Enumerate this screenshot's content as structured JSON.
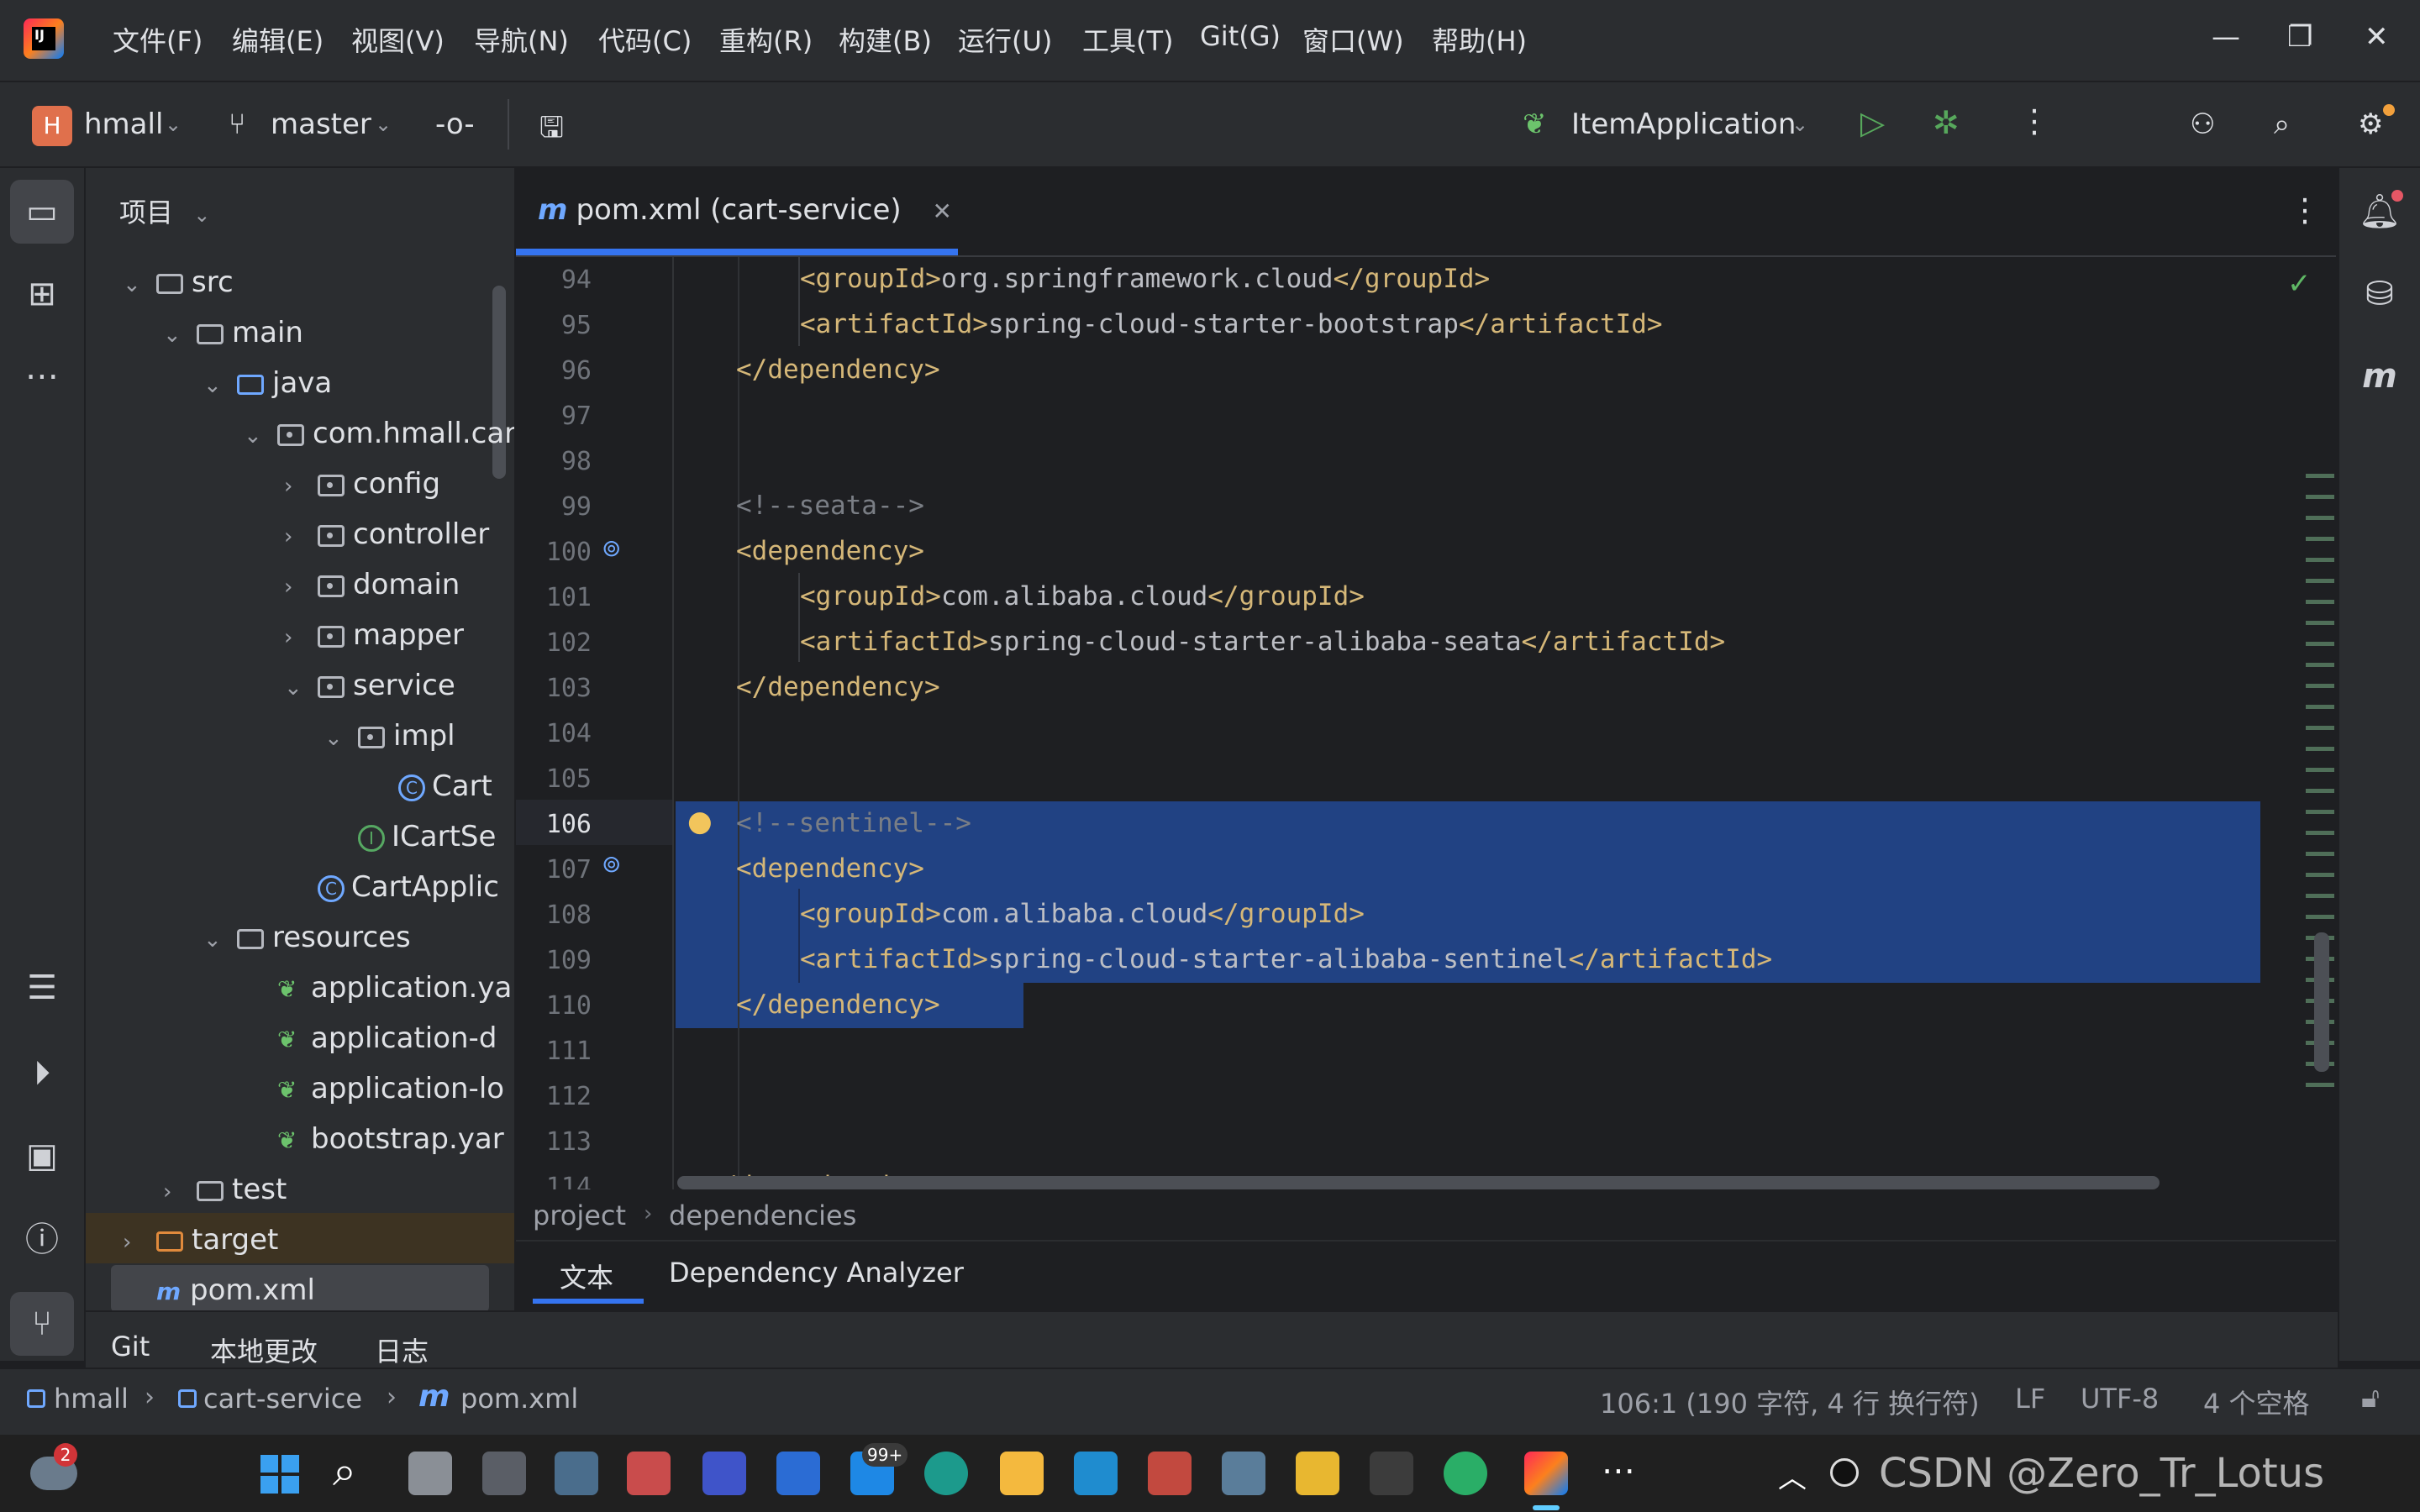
{
  "menu": {
    "items": [
      "文件(F)",
      "编辑(E)",
      "视图(V)",
      "导航(N)",
      "代码(C)",
      "重构(R)",
      "构建(B)",
      "运行(U)",
      "工具(T)",
      "Git(G)",
      "窗口(W)",
      "帮助(H)"
    ]
  },
  "toolbar": {
    "project_letter": "H",
    "project_name": "hmall",
    "branch": "master",
    "run_config": "ItemApplication"
  },
  "project_panel": {
    "title": "项目",
    "tree": [
      {
        "label": "src",
        "type": "folder",
        "expanded": true
      },
      {
        "label": "main",
        "type": "folder",
        "expanded": true
      },
      {
        "label": "java",
        "type": "source-folder",
        "expanded": true
      },
      {
        "label": "com.hmall.cart",
        "type": "package",
        "expanded": true
      },
      {
        "label": "config",
        "type": "package",
        "expanded": false
      },
      {
        "label": "controller",
        "type": "package",
        "expanded": false
      },
      {
        "label": "domain",
        "type": "package",
        "expanded": false
      },
      {
        "label": "mapper",
        "type": "package",
        "expanded": false
      },
      {
        "label": "service",
        "type": "package",
        "expanded": true
      },
      {
        "label": "impl",
        "type": "package",
        "expanded": true
      },
      {
        "label": "Cart",
        "type": "class"
      },
      {
        "label": "ICartSe",
        "type": "interface"
      },
      {
        "label": "CartApplic",
        "type": "class"
      },
      {
        "label": "resources",
        "type": "resource-folder",
        "expanded": true
      },
      {
        "label": "application.ya",
        "type": "spring-config"
      },
      {
        "label": "application-d",
        "type": "spring-config"
      },
      {
        "label": "application-lo",
        "type": "spring-config"
      },
      {
        "label": "bootstrap.yar",
        "type": "spring-config"
      },
      {
        "label": "test",
        "type": "folder",
        "expanded": false
      },
      {
        "label": "target",
        "type": "excluded-folder",
        "expanded": false
      },
      {
        "label": "pom.xml",
        "type": "maven"
      }
    ]
  },
  "editor": {
    "tab_label": "pom.xml (cart-service)",
    "lines": [
      {
        "num": "94",
        "indent": 2,
        "parts": [
          [
            "tag",
            "<groupId>"
          ],
          [
            "txt",
            "org.springframework.cloud"
          ],
          [
            "tag",
            "</groupId>"
          ]
        ]
      },
      {
        "num": "95",
        "indent": 2,
        "parts": [
          [
            "tag",
            "<artifactId>"
          ],
          [
            "txt",
            "spring-cloud-starter-bootstrap"
          ],
          [
            "tag",
            "</artifactId>"
          ]
        ]
      },
      {
        "num": "96",
        "indent": 1,
        "parts": [
          [
            "tag",
            "</dependency>"
          ]
        ]
      },
      {
        "num": "97",
        "indent": 0,
        "parts": []
      },
      {
        "num": "98",
        "indent": 0,
        "parts": []
      },
      {
        "num": "99",
        "indent": 1,
        "parts": [
          [
            "cmt",
            "<!--seata-->"
          ]
        ]
      },
      {
        "num": "100",
        "indent": 1,
        "parts": [
          [
            "tag",
            "<dependency>"
          ]
        ]
      },
      {
        "num": "101",
        "indent": 2,
        "parts": [
          [
            "tag",
            "<groupId>"
          ],
          [
            "txt",
            "com.alibaba.cloud"
          ],
          [
            "tag",
            "</groupId>"
          ]
        ]
      },
      {
        "num": "102",
        "indent": 2,
        "parts": [
          [
            "tag",
            "<artifactId>"
          ],
          [
            "txt",
            "spring-cloud-starter-alibaba-seata"
          ],
          [
            "tag",
            "</artifactId>"
          ]
        ]
      },
      {
        "num": "103",
        "indent": 1,
        "parts": [
          [
            "tag",
            "</dependency>"
          ]
        ]
      },
      {
        "num": "104",
        "indent": 0,
        "parts": []
      },
      {
        "num": "105",
        "indent": 0,
        "parts": []
      },
      {
        "num": "106",
        "indent": 1,
        "parts": [
          [
            "cmt",
            "<!--sentinel-->"
          ]
        ]
      },
      {
        "num": "107",
        "indent": 1,
        "parts": [
          [
            "tag",
            "<dependency>"
          ]
        ]
      },
      {
        "num": "108",
        "indent": 2,
        "parts": [
          [
            "tag",
            "<groupId>"
          ],
          [
            "txt",
            "com.alibaba.cloud"
          ],
          [
            "tag",
            "</groupId>"
          ]
        ]
      },
      {
        "num": "109",
        "indent": 2,
        "parts": [
          [
            "tag",
            "<artifactId>"
          ],
          [
            "txt",
            "spring-cloud-starter-alibaba-sentinel"
          ],
          [
            "tag",
            "</artifactId>"
          ]
        ]
      },
      {
        "num": "110",
        "indent": 1,
        "parts": [
          [
            "tag",
            "</dependency>"
          ]
        ]
      },
      {
        "num": "111",
        "indent": 0,
        "parts": []
      },
      {
        "num": "112",
        "indent": 0,
        "parts": []
      },
      {
        "num": "113",
        "indent": 0,
        "parts": []
      },
      {
        "num": "114",
        "indent": 0,
        "parts": [
          [
            "tag",
            "</dependencies>"
          ]
        ]
      }
    ],
    "current_line": "106"
  },
  "breadcrumb": {
    "items": [
      "project",
      "dependencies"
    ]
  },
  "editor_tabs": {
    "text": "文本",
    "analyzer": "Dependency Analyzer"
  },
  "git_tabs": {
    "git": "Git",
    "local_changes": "本地更改",
    "log": "日志"
  },
  "status": {
    "path": [
      "hmall",
      "cart-service",
      "pom.xml"
    ],
    "position": "106:1 (190 字符, 4 行 换行符)",
    "line_separator": "LF",
    "encoding": "UTF-8",
    "indent": "4 个空格"
  },
  "taskbar": {
    "notification_count": "2",
    "badge_99": "99+",
    "overlay_text": "CSDN @Zero_Tr_Lotus"
  },
  "colors": {
    "accent": "#3574f0",
    "selection": "#214283",
    "tag": "#d5b778",
    "comment": "#7a7e85"
  }
}
